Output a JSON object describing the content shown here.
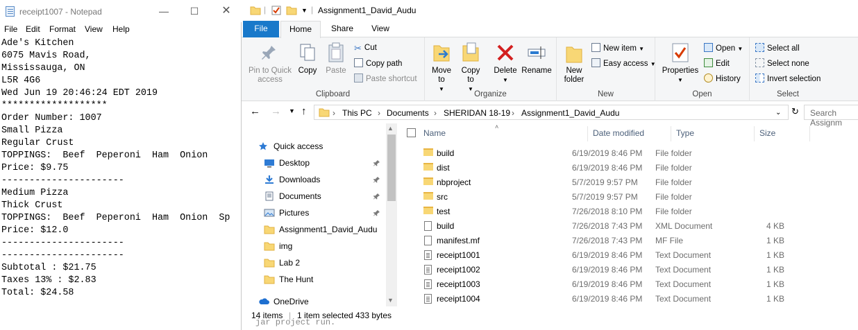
{
  "notepad": {
    "title": "receipt1007 - Notepad",
    "menu": [
      "File",
      "Edit",
      "Format",
      "View",
      "Help"
    ],
    "lines": [
      "Ade's Kitchen",
      "6075 Mavis Road,",
      "Mississauga, ON",
      "L5R 4G6",
      "Wed Jun 19 20:46:24 EDT 2019",
      "*******************",
      "Order Number: 1007",
      "Small Pizza",
      "Regular Crust",
      "TOPPINGS:  Beef  Peperoni  Ham  Onion",
      "Price: $9.75",
      "----------------------",
      "Medium Pizza",
      "Thick Crust",
      "TOPPINGS:  Beef  Peperoni  Ham  Onion  Sp",
      "Price: $12.0",
      "----------------------",
      "----------------------",
      "Subtotal : $21.75",
      "Taxes 13% : $2.83",
      "Total: $24.58"
    ]
  },
  "explorer": {
    "title": "Assignment1_David_Audu",
    "tabs": [
      "File",
      "Home",
      "Share",
      "View"
    ],
    "ribbon": {
      "clipboard": {
        "label": "Clipboard",
        "pin": "Pin to Quick access",
        "copy": "Copy",
        "paste": "Paste",
        "cut": "Cut",
        "copy_path": "Copy path",
        "paste_shortcut": "Paste shortcut"
      },
      "organize": {
        "label": "Organize",
        "move_to": "Move to",
        "copy_to": "Copy to",
        "delete": "Delete",
        "rename": "Rename"
      },
      "new": {
        "label": "New",
        "new_folder": "New folder",
        "new_item": "New item",
        "easy_access": "Easy access"
      },
      "open": {
        "label": "Open",
        "properties": "Properties",
        "open": "Open",
        "edit": "Edit",
        "history": "History"
      },
      "select": {
        "label": "Select",
        "select_all": "Select all",
        "select_none": "Select none",
        "invert": "Invert selection"
      }
    },
    "breadcrumb": [
      "This PC",
      "Documents",
      "SHERIDAN 18-19",
      "Assignment1_David_Audu"
    ],
    "search_placeholder": "Search Assignm",
    "nav": [
      {
        "label": "Quick access",
        "icon": "star-icon",
        "pinned": false
      },
      {
        "label": "Desktop",
        "icon": "desktop-icon",
        "pinned": true
      },
      {
        "label": "Downloads",
        "icon": "download-icon",
        "pinned": true
      },
      {
        "label": "Documents",
        "icon": "documents-icon",
        "pinned": true
      },
      {
        "label": "Pictures",
        "icon": "pictures-icon",
        "pinned": true
      },
      {
        "label": "Assignment1_David_Audu",
        "icon": "folder-icon",
        "pinned": false
      },
      {
        "label": "img",
        "icon": "folder-icon",
        "pinned": false
      },
      {
        "label": "Lab 2",
        "icon": "folder-icon",
        "pinned": false
      },
      {
        "label": "The Hunt",
        "icon": "folder-icon",
        "pinned": false
      },
      {
        "label": "OneDrive",
        "icon": "onedrive-icon",
        "pinned": false
      }
    ],
    "columns": {
      "name": "Name",
      "date": "Date modified",
      "type": "Type",
      "size": "Size"
    },
    "files": [
      {
        "name": "build",
        "date": "6/19/2019 8:46 PM",
        "type": "File folder",
        "size": "",
        "kind": "folder"
      },
      {
        "name": "dist",
        "date": "6/19/2019 8:46 PM",
        "type": "File folder",
        "size": "",
        "kind": "folder"
      },
      {
        "name": "nbproject",
        "date": "5/7/2019 9:57 PM",
        "type": "File folder",
        "size": "",
        "kind": "folder"
      },
      {
        "name": "src",
        "date": "5/7/2019 9:57 PM",
        "type": "File folder",
        "size": "",
        "kind": "folder"
      },
      {
        "name": "test",
        "date": "7/26/2018 8:10 PM",
        "type": "File folder",
        "size": "",
        "kind": "folder"
      },
      {
        "name": "build",
        "date": "7/26/2018 7:43 PM",
        "type": "XML Document",
        "size": "4 KB",
        "kind": "doc"
      },
      {
        "name": "manifest.mf",
        "date": "7/26/2018 7:43 PM",
        "type": "MF File",
        "size": "1 KB",
        "kind": "doc"
      },
      {
        "name": "receipt1001",
        "date": "6/19/2019 8:46 PM",
        "type": "Text Document",
        "size": "1 KB",
        "kind": "txt"
      },
      {
        "name": "receipt1002",
        "date": "6/19/2019 8:46 PM",
        "type": "Text Document",
        "size": "1 KB",
        "kind": "txt"
      },
      {
        "name": "receipt1003",
        "date": "6/19/2019 8:46 PM",
        "type": "Text Document",
        "size": "1 KB",
        "kind": "txt"
      },
      {
        "name": "receipt1004",
        "date": "6/19/2019 8:46 PM",
        "type": "Text Document",
        "size": "1 KB",
        "kind": "txt"
      }
    ],
    "status": {
      "count": "14 items",
      "selected": "1 item selected",
      "size": "433 bytes"
    },
    "background_text": "jar project run."
  }
}
